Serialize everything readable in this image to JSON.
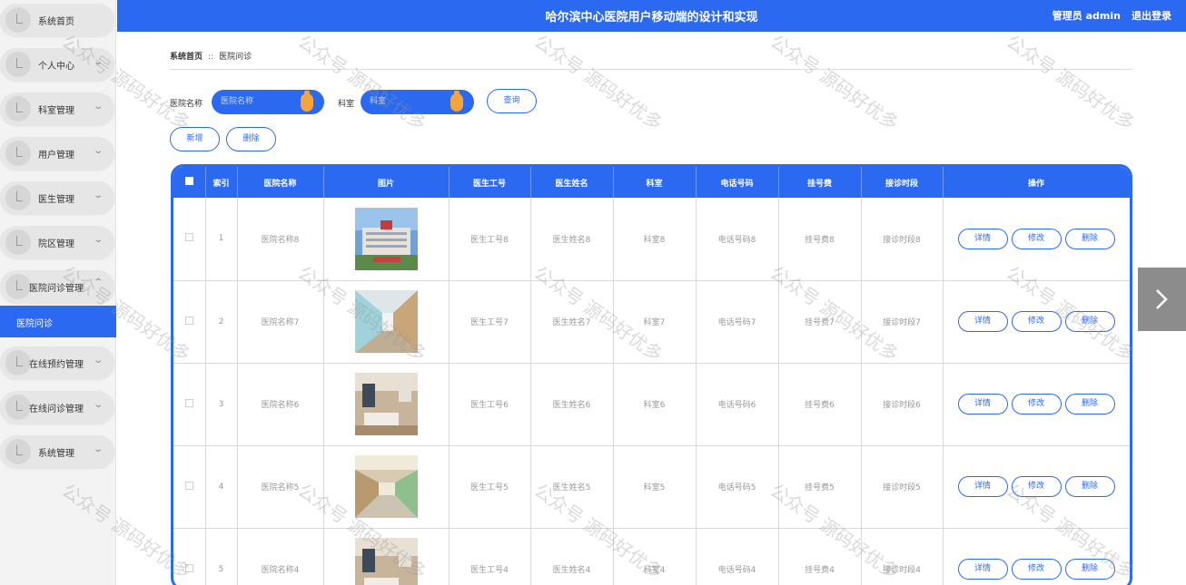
{
  "header": {
    "title": "哈尔滨中心医院用户移动端的设计和实现",
    "user": "管理员 admin",
    "logout": "退出登录"
  },
  "sidebar": {
    "items": [
      {
        "label": "系统首页",
        "chevron": false
      },
      {
        "label": "个人中心",
        "chevron": true
      },
      {
        "label": "科室管理",
        "chevron": true
      },
      {
        "label": "用户管理",
        "chevron": true
      },
      {
        "label": "医生管理",
        "chevron": true
      },
      {
        "label": "院区管理",
        "chevron": true
      },
      {
        "label": "医院问诊管理",
        "chevron": true,
        "open": true
      },
      {
        "label": "在线预约管理",
        "chevron": true
      },
      {
        "label": "在线问诊管理",
        "chevron": true
      },
      {
        "label": "系统管理",
        "chevron": true
      }
    ],
    "active_sub": "医院问诊"
  },
  "breadcrumb": {
    "home": "系统首页",
    "sep": "::",
    "current": "医院问诊"
  },
  "search": {
    "hospital_label": "医院名称",
    "hospital_placeholder": "医院名称",
    "dept_label": "科室",
    "dept_placeholder": "科室",
    "query_button": "查询"
  },
  "actions": {
    "add": "新增",
    "delete": "删除"
  },
  "table": {
    "columns": [
      "索引",
      "医院名称",
      "图片",
      "医生工号",
      "医生姓名",
      "科室",
      "电话号码",
      "挂号费",
      "接诊时段",
      "操作"
    ],
    "row_actions": [
      "详情",
      "修改",
      "删除"
    ],
    "rows": [
      {
        "index": "1",
        "hospital": "医院名称8",
        "doctor_id": "医生工号8",
        "doctor_name": "医生姓名8",
        "dept": "科室8",
        "phone": "电话号码8",
        "fee": "挂号费8",
        "period": "接诊时段8",
        "image": "hospital-building"
      },
      {
        "index": "2",
        "hospital": "医院名称7",
        "doctor_id": "医生工号7",
        "doctor_name": "医生姓名7",
        "dept": "科室7",
        "phone": "电话号码7",
        "fee": "挂号费7",
        "period": "接诊时段7",
        "image": "hospital-corridor"
      },
      {
        "index": "3",
        "hospital": "医院名称6",
        "doctor_id": "医生工号6",
        "doctor_name": "医生姓名6",
        "dept": "科室6",
        "phone": "电话号码6",
        "fee": "挂号费6",
        "period": "接诊时段6",
        "image": "hospital-ward"
      },
      {
        "index": "4",
        "hospital": "医院名称5",
        "doctor_id": "医生工号5",
        "doctor_name": "医生姓名5",
        "dept": "科室5",
        "phone": "电话号码5",
        "fee": "挂号费5",
        "period": "接诊时段5",
        "image": "hospital-hall"
      },
      {
        "index": "5",
        "hospital": "医院名称4",
        "doctor_id": "医生工号4",
        "doctor_name": "医生姓名4",
        "dept": "科室4",
        "phone": "电话号码4",
        "fee": "挂号费4",
        "period": "接诊时段4",
        "image": "hospital-ward"
      }
    ]
  },
  "watermark": "公众号 源码好优多",
  "colors": {
    "accent": "#2b6af0",
    "knob": "#f7a53b",
    "sidebar_bg": "#f3f3f3"
  }
}
